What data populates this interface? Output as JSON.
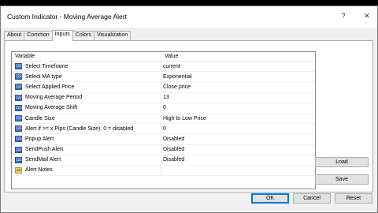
{
  "window": {
    "title": "Custom Indicator - Moving Average Alert",
    "help_glyph": "?",
    "close_glyph": "✕"
  },
  "tabs": [
    {
      "label": "About"
    },
    {
      "label": "Common"
    },
    {
      "label": "Inputs"
    },
    {
      "label": "Colors"
    },
    {
      "label": "Visualization"
    }
  ],
  "grid": {
    "headers": {
      "variable": "Variable",
      "value": "Value"
    },
    "rows": [
      {
        "type_icon": "123",
        "variable": "Select Timeframe",
        "value": "current"
      },
      {
        "type_icon": "123",
        "variable": "Select MA type",
        "value": "Exponential"
      },
      {
        "type_icon": "123",
        "variable": "Select Applied Price",
        "value": "Close price"
      },
      {
        "type_icon": "123",
        "variable": "Moving Average Period",
        "value": "13"
      },
      {
        "type_icon": "123",
        "variable": "Moving Average Shift",
        "value": "0"
      },
      {
        "type_icon": "123",
        "variable": "Candle Size",
        "value": "High to Low Price"
      },
      {
        "type_icon": "123",
        "variable": "Alert if >= x Pips (Candle Size). 0 = disabled",
        "value": "0"
      },
      {
        "type_icon": "123",
        "variable": "Popup Alert",
        "value": "Disabled"
      },
      {
        "type_icon": "123",
        "variable": "SendPush Alert",
        "value": "Disabled"
      },
      {
        "type_icon": "123",
        "variable": "SendMail Alert",
        "value": "Disabled"
      },
      {
        "type_icon": "ab",
        "variable": "Alert Notes",
        "value": ""
      }
    ]
  },
  "side_buttons": {
    "load": "Load",
    "save": "Save"
  },
  "footer_buttons": {
    "ok": "OK",
    "cancel": "Cancel",
    "reset": "Reset"
  }
}
